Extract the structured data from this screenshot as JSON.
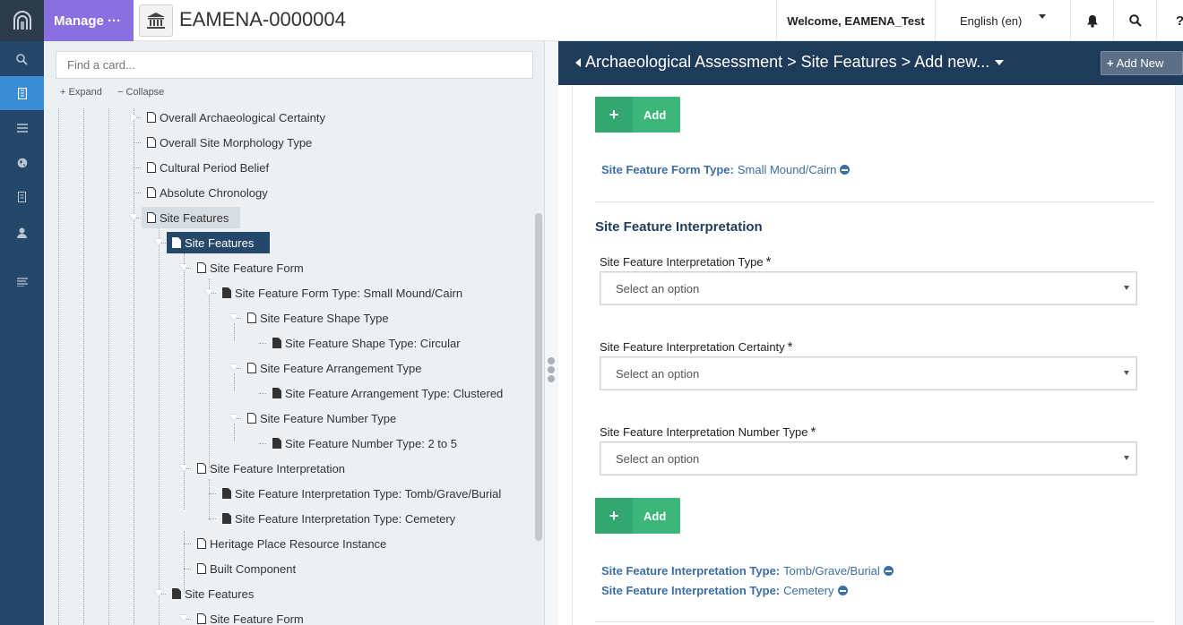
{
  "topbar": {
    "manage_label": "Manage ···",
    "resource_title": "EAMENA-0000004",
    "welcome": "Welcome, EAMENA_Test",
    "language": "English (en)"
  },
  "rail": {
    "items": [
      "search-icon",
      "resource-editor-icon",
      "list-icon",
      "globe-icon",
      "document-icon",
      "user-icon",
      "menu-icon"
    ]
  },
  "tree_panel": {
    "search_placeholder": "Find a card...",
    "expand_label": "Expand",
    "collapse_label": "Collapse",
    "nodes": [
      "Overall Archaeological Certainty",
      "Overall Site Morphology Type",
      "Cultural Period Belief",
      "Absolute Chronology",
      "Site Features",
      "Site Features",
      "Site Feature Form",
      "Site Feature Form Type: Small Mound/Cairn",
      "Site Feature Shape Type",
      "Site Feature Shape Type: Circular",
      "Site Feature Arrangement Type",
      "Site Feature Arrangement Type: Clustered",
      "Site Feature Number Type",
      "Site Feature Number Type: 2 to 5",
      "Site Feature Interpretation",
      "Site Feature Interpretation Type: Tomb/Grave/Burial",
      "Site Feature Interpretation Type: Cemetery",
      "Heritage Place Resource Instance",
      "Built Component",
      "Site Features",
      "Site Feature Form"
    ]
  },
  "form": {
    "breadcrumb": "Archaeological Assessment > Site Features > Add new...",
    "add_new_label": "Add New",
    "add_label": "Add",
    "form_type": {
      "key": "Site Feature Form Type",
      "value": "Small Mound/Cairn"
    },
    "section_title": "Site Feature Interpretation",
    "fields": [
      {
        "label": "Site Feature Interpretation Type",
        "placeholder": "Select an option"
      },
      {
        "label": "Site Feature Interpretation Certainty",
        "placeholder": "Select an option"
      },
      {
        "label": "Site Feature Interpretation Number Type",
        "placeholder": "Select an option"
      }
    ],
    "required_mark": "*",
    "interp_values": [
      {
        "key": "Site Feature Interpretation Type",
        "value": "Tomb/Grave/Burial"
      },
      {
        "key": "Site Feature Interpretation Type",
        "value": "Cemetery"
      }
    ]
  }
}
